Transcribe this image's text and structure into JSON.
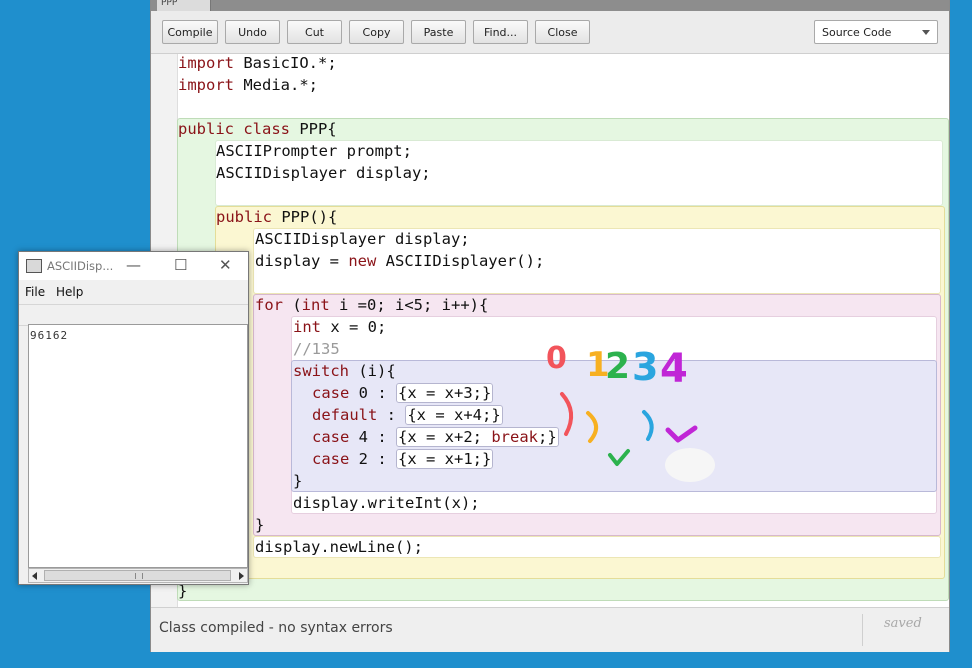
{
  "editor": {
    "tab_label": "PPP",
    "toolbar": {
      "compile": "Compile",
      "undo": "Undo",
      "cut": "Cut",
      "copy": "Copy",
      "paste": "Paste",
      "find": "Find...",
      "close": "Close",
      "view_select": "Source Code"
    },
    "code": {
      "l1": [
        "import",
        " BasicIO.*;"
      ],
      "l2": [
        "import",
        " Media.*;"
      ],
      "l4": [
        "public class",
        " PPP{"
      ],
      "l5": "ASCIIPrompter prompt;",
      "l6": "ASCIIDisplayer display;",
      "l8": [
        "public",
        " PPP(){"
      ],
      "l9": "ASCIIDisplayer display;",
      "l10": [
        "display = ",
        "new",
        " ASCIIDisplayer();"
      ],
      "l12": [
        "for",
        " (",
        "int",
        " i =0; i<5; i++){"
      ],
      "l13": [
        "int",
        " x = 0;"
      ],
      "l14": "//135",
      "l15": [
        "switch",
        " (i){"
      ],
      "l16": [
        "case",
        " 0 : ",
        "{x = x+3;}"
      ],
      "l17": [
        "default",
        " : ",
        "{x = x+4;}"
      ],
      "l18": [
        "case",
        " 4 : ",
        "{x = x+2; ",
        "break",
        ";}"
      ],
      "l19": [
        "case",
        " 2 : ",
        "{x = x+1;}"
      ],
      "l20": "}",
      "l21": "display.writeInt(x);",
      "l22": "}",
      "l23": "display.newLine();",
      "l24": "}"
    },
    "status": "Class compiled - no syntax errors",
    "saved": "saved"
  },
  "ascii_window": {
    "title": "ASCIIDisp...",
    "menu": {
      "file": "File",
      "help": "Help"
    },
    "output": "96162"
  },
  "annotations": {
    "digits": [
      "0",
      "1",
      "2",
      "3",
      "4"
    ],
    "colors": {
      "red": "#f2545b",
      "orange": "#f7b021",
      "green": "#2cb24d",
      "blue": "#2aa5df",
      "purple": "#c026d6"
    }
  }
}
